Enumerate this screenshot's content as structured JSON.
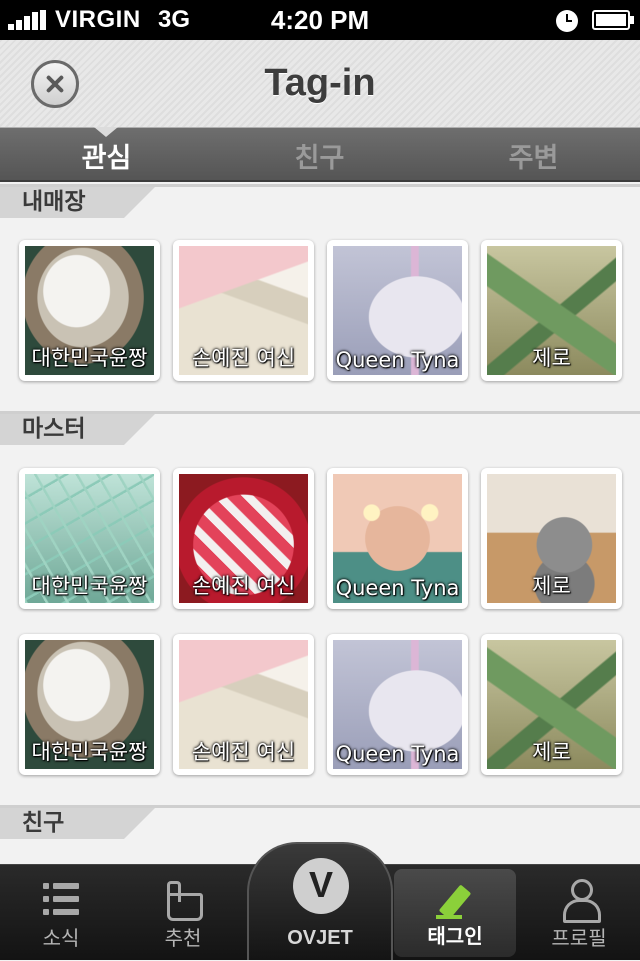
{
  "status_bar": {
    "carrier": "VIRGIN",
    "network": "3G",
    "time": "4:20 PM",
    "icons": [
      "signal-icon",
      "alarm-icon",
      "battery-icon"
    ]
  },
  "nav": {
    "title": "Tag-in",
    "close_icon": "close-icon"
  },
  "segments": [
    {
      "label": "관심",
      "active": true
    },
    {
      "label": "친구",
      "active": false
    },
    {
      "label": "주변",
      "active": false
    }
  ],
  "sections": {
    "my_store": {
      "label": "내매장",
      "tiles": [
        {
          "caption": "대한민국윤짱",
          "photo": "cup"
        },
        {
          "caption": "손예진 여신",
          "photo": "book"
        },
        {
          "caption": "Queen Tyna",
          "photo": "shake"
        },
        {
          "caption": "제로",
          "photo": "origami"
        }
      ]
    },
    "master": {
      "label": "마스터",
      "tiles": [
        {
          "caption": "대한민국윤짱",
          "photo": "hanger"
        },
        {
          "caption": "손예진 여신",
          "photo": "candy"
        },
        {
          "caption": "Queen Tyna",
          "photo": "chandelier"
        },
        {
          "caption": "제로",
          "photo": "bear"
        },
        {
          "caption": "대한민국윤짱",
          "photo": "cup"
        },
        {
          "caption": "손예진 여신",
          "photo": "book"
        },
        {
          "caption": "Queen Tyna",
          "photo": "shake"
        },
        {
          "caption": "제로",
          "photo": "origami"
        }
      ]
    },
    "friends": {
      "label": "친구"
    }
  },
  "tab_bar": {
    "items": [
      {
        "label": "소식",
        "icon": "list-icon",
        "active": false
      },
      {
        "label": "추천",
        "icon": "hand-icon",
        "active": false
      },
      {
        "label": "OVJET",
        "icon": "ovjet-logo-icon",
        "active": false
      },
      {
        "label": "태그인",
        "icon": "pen-icon",
        "active": true
      },
      {
        "label": "프로필",
        "icon": "person-icon",
        "active": false
      }
    ]
  },
  "colors": {
    "status_bar_bg": "#000000",
    "segment_bar_bg": "#5f5f5f",
    "tab_bar_bg": "#1e1e1e",
    "active_icon": "#8bd03a",
    "section_label_bg": "#d4d4d4"
  }
}
